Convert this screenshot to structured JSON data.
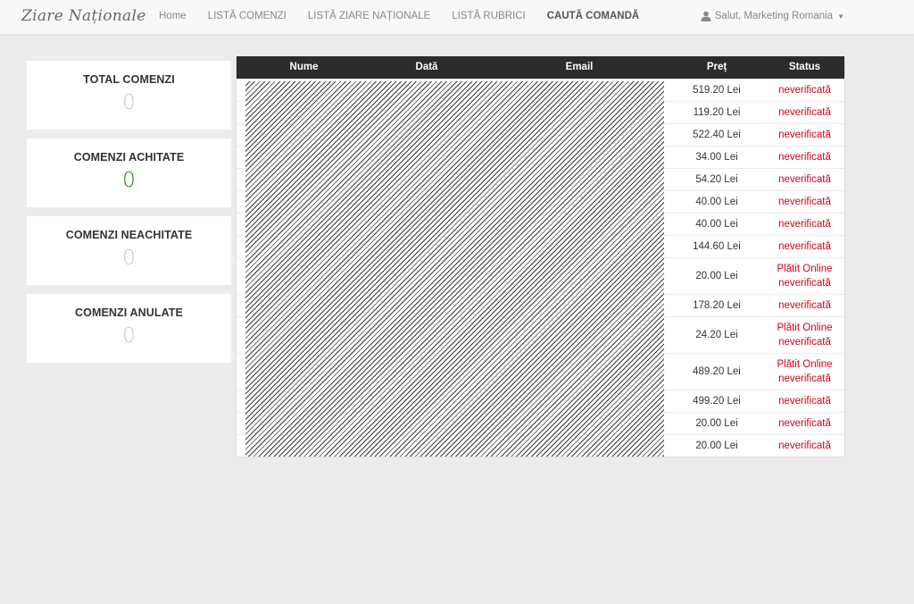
{
  "nav": {
    "brand": "Ziare Naționale",
    "links": [
      {
        "label": "Home"
      },
      {
        "label": "LISTĂ COMENZI"
      },
      {
        "label": "LISTĂ ZIARE NAȚIONALE"
      },
      {
        "label": "LISTĂ RUBRICI"
      },
      {
        "label": "CAUTĂ COMANDĂ"
      }
    ],
    "active_index": 4,
    "user_label": "Salut, Marketing Romania"
  },
  "stats": [
    {
      "title": "TOTAL COMENZI",
      "value": "0"
    },
    {
      "title": "COMENZI ACHITATE",
      "value": "0"
    },
    {
      "title": "COMENZI NEACHITATE",
      "value": "0"
    },
    {
      "title": "COMENZI ANULATE",
      "value": "0"
    }
  ],
  "table": {
    "headers": {
      "nume": "Nume",
      "data": "Dată",
      "email": "Email",
      "pret": "Preț",
      "status": "Status"
    },
    "rows": [
      {
        "pret": "519.20 Lei",
        "status": [
          "neverificată"
        ]
      },
      {
        "pret": "119.20 Lei",
        "status": [
          "neverificată"
        ]
      },
      {
        "pret": "522.40 Lei",
        "status": [
          "neverificată"
        ]
      },
      {
        "pret": "34.00 Lei",
        "status": [
          "neverificată"
        ]
      },
      {
        "pret": "54.20 Lei",
        "status": [
          "neverificată"
        ]
      },
      {
        "pret": "40.00 Lei",
        "status": [
          "neverificată"
        ]
      },
      {
        "pret": "40.00 Lei",
        "status": [
          "neverificată"
        ]
      },
      {
        "pret": "144.60 Lei",
        "status": [
          "neverificată"
        ]
      },
      {
        "pret": "20.00 Lei",
        "status": [
          "Plătit Online",
          "neverificată"
        ]
      },
      {
        "pret": "178.20 Lei",
        "status": [
          "neverificată"
        ]
      },
      {
        "pret": "24.20 Lei",
        "status": [
          "Plătit Online",
          "neverificată"
        ]
      },
      {
        "pret": "489.20 Lei",
        "status": [
          "Plătit Online",
          "neverificată"
        ]
      },
      {
        "pret": "499.20 Lei",
        "status": [
          "neverificată"
        ]
      },
      {
        "pret": "20.00 Lei",
        "status": [
          "neverificată"
        ]
      },
      {
        "pret": "20.00 Lei",
        "status": [
          "neverificată"
        ]
      }
    ]
  },
  "colors": {
    "status_red": "#d0021b",
    "paid_green": "#1e8a1e",
    "header_dark": "#2c2c2c"
  }
}
